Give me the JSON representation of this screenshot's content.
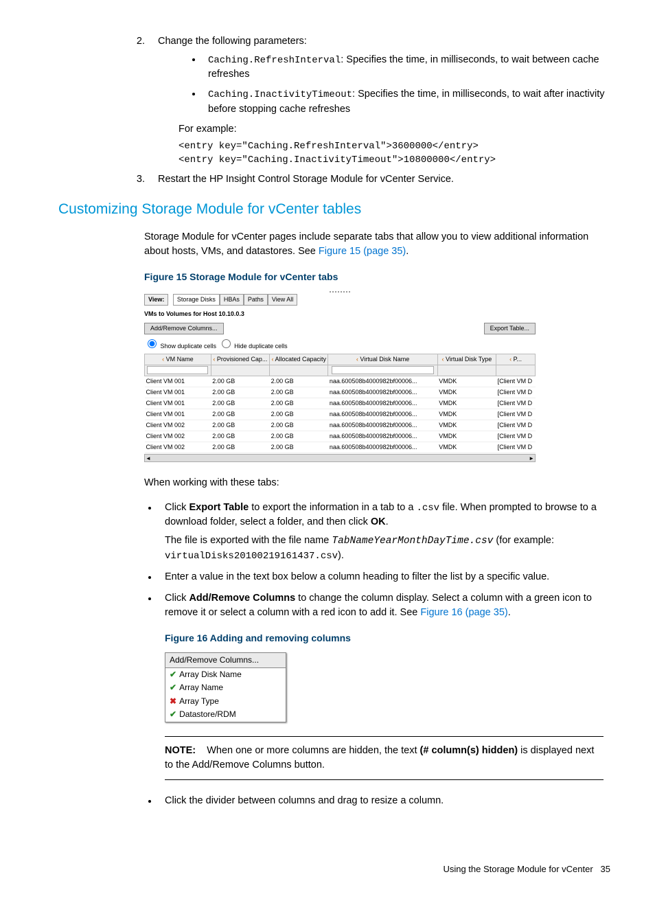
{
  "step2": {
    "text": "Change the following parameters:",
    "bullet1_code": "Caching.RefreshInterval",
    "bullet1_text": ": Specifies the time, in milliseconds, to wait between cache refreshes",
    "bullet2_code": "Caching.InactivityTimeout",
    "bullet2_text": ": Specifies the time, in milliseconds, to wait after inactivity before stopping cache refreshes",
    "example_label": "For example:",
    "example_code": "<entry key=\"Caching.RefreshInterval\">3600000</entry>\n<entry key=\"Caching.InactivityTimeout\">10800000</entry>"
  },
  "step3": "Restart the HP Insight Control Storage Module for vCenter Service.",
  "h2": "Customizing Storage Module for vCenter tables",
  "intro_p1": "Storage Module for vCenter pages include separate tabs that allow you to view additional information about hosts, VMs, and datastores. See ",
  "intro_link": "Figure 15 (page 35)",
  "fig15_cap": "Figure 15 Storage Module for vCenter tabs",
  "fig15": {
    "view_label": "View:",
    "tabs": [
      "Storage Disks",
      "HBAs",
      "Paths",
      "View All"
    ],
    "subtitle": "VMs to Volumes for Host 10.10.0.3",
    "btn_addremove": "Add/Remove Columns...",
    "btn_export": "Export Table...",
    "radio_show": "Show duplicate cells",
    "radio_hide": "Hide duplicate cells",
    "cols": [
      "VM Name",
      "Provisioned Cap...",
      "Allocated Capacity",
      "Virtual Disk Name",
      "Virtual Disk Type",
      "P..."
    ],
    "rows": [
      [
        "Client VM 001",
        "2.00 GB",
        "2.00 GB",
        "naa.600508b4000982bf00006...",
        "VMDK",
        "[Client VM D"
      ],
      [
        "Client VM 001",
        "2.00 GB",
        "2.00 GB",
        "naa.600508b4000982bf00006...",
        "VMDK",
        "[Client VM D"
      ],
      [
        "Client VM 001",
        "2.00 GB",
        "2.00 GB",
        "naa.600508b4000982bf00006...",
        "VMDK",
        "[Client VM D"
      ],
      [
        "Client VM 001",
        "2.00 GB",
        "2.00 GB",
        "naa.600508b4000982bf00006...",
        "VMDK",
        "[Client VM D"
      ],
      [
        "Client VM 002",
        "2.00 GB",
        "2.00 GB",
        "naa.600508b4000982bf00006...",
        "VMDK",
        "[Client VM D"
      ],
      [
        "Client VM 002",
        "2.00 GB",
        "2.00 GB",
        "naa.600508b4000982bf00006...",
        "VMDK",
        "[Client VM D"
      ],
      [
        "Client VM 002",
        "2.00 GB",
        "2.00 GB",
        "naa.600508b4000982bf00006...",
        "VMDK",
        "[Client VM D"
      ]
    ]
  },
  "after_fig_p": "When working with these tabs:",
  "bul1": {
    "a": "Click ",
    "b": "Export Table",
    "c": " to export the information in a tab to a ",
    "d": ".csv",
    "e": " file. When prompted to browse to a download folder, select a folder, and then click ",
    "f": "OK",
    "g": ".",
    "p2a": "The file is exported with the file name ",
    "p2b": "TabNameYearMonthDayTime.csv",
    "p2c": " (for example: ",
    "p2d": "virtualDisks20100219161437.csv",
    "p2e": ")."
  },
  "bul2": "Enter a value in the text box below a column heading to filter the list by a specific value.",
  "bul3": {
    "a": "Click ",
    "b": "Add/Remove Columns",
    "c": " to change the column display. Select a column with a green icon to remove it or select a column with a red icon to add it. See ",
    "link": "Figure 16 (page 35)",
    "d": "."
  },
  "fig16_cap": "Figure 16 Adding and removing columns",
  "fig16": {
    "header": "Add/Remove Columns...",
    "items": [
      {
        "icon": "chk",
        "label": "Array Disk Name"
      },
      {
        "icon": "chk",
        "label": "Array Name"
      },
      {
        "icon": "x",
        "label": "Array Type"
      },
      {
        "icon": "chk",
        "label": "Datastore/RDM"
      }
    ]
  },
  "note": {
    "label": "NOTE:",
    "a": "When one or more columns are hidden, the text ",
    "b": "(# column(s) hidden)",
    "c": " is displayed next to the Add/Remove Columns button."
  },
  "bul4": "Click the divider between columns and drag to resize a column.",
  "footer": {
    "text": "Using the Storage Module for vCenter",
    "page": "35"
  }
}
